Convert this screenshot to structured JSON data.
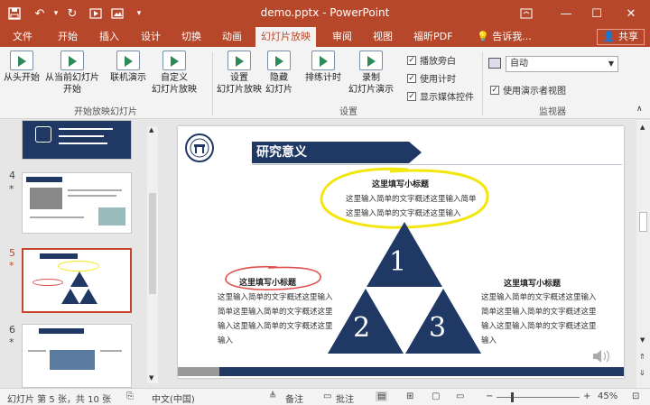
{
  "titlebar": {
    "doc_title": "demo.pptx - PowerPoint",
    "save_icon": "save-icon",
    "undo_icon": "undo-icon",
    "redo_icon": "redo-icon",
    "start_icon": "start-icon",
    "dropdown_icon": "chevron-down-icon"
  },
  "tabs": [
    "文件",
    "开始",
    "插入",
    "设计",
    "切换",
    "动画",
    "幻灯片放映",
    "审阅",
    "视图",
    "福昕PDF",
    "告诉我..."
  ],
  "active_tab": "幻灯片放映",
  "share_label": "共享",
  "ribbon": {
    "buttons": [
      "从头开始",
      "从当前幻灯片\n开始",
      "联机演示",
      "自定义\n幻灯片放映",
      "设置\n幻灯片放映",
      "隐藏\n幻灯片",
      "排练计时",
      "录制\n幻灯片演示"
    ],
    "checks": [
      "播放旁白",
      "使用计时",
      "显示媒体控件"
    ],
    "monitor_value": "自动",
    "presenter_view": "使用演示者视图",
    "groups": [
      "开始放映幻灯片",
      "设置",
      "监视器"
    ]
  },
  "thumbnails": [
    {
      "num": "4",
      "star": "*"
    },
    {
      "num": "5",
      "star": "*"
    },
    {
      "num": "6",
      "star": "*"
    }
  ],
  "slide": {
    "title": "研究意义",
    "top_head": "这里填写小标题",
    "top_body": "这里输入简单的文字概述这里输入简单这里输入简单的文字概述这里输入",
    "left_head": "这里填写小标题",
    "left_body": "这里输入简单的文字概述这里输入简单这里输入简单的文字概述这里输入这里输入简单的文字概述这里输入",
    "right_head": "这里填写小标题",
    "right_body": "这里输入简单的文字概述这里输入简单这里输入简单的文字概述这里输入这里输入简单的文字概述这里输入",
    "tri1": "1",
    "tri2": "2",
    "tri3": "3",
    "navy": "#1f3864"
  },
  "status": {
    "slide_info": "幻灯片 第 5 张，共 10 张",
    "language": "中文(中国)",
    "notes": "备注",
    "comments": "批注",
    "zoom": "45%"
  },
  "colors": {
    "accent": "#b7472a",
    "highlight_yellow": "#f3e60a",
    "highlight_red": "#e05050"
  }
}
